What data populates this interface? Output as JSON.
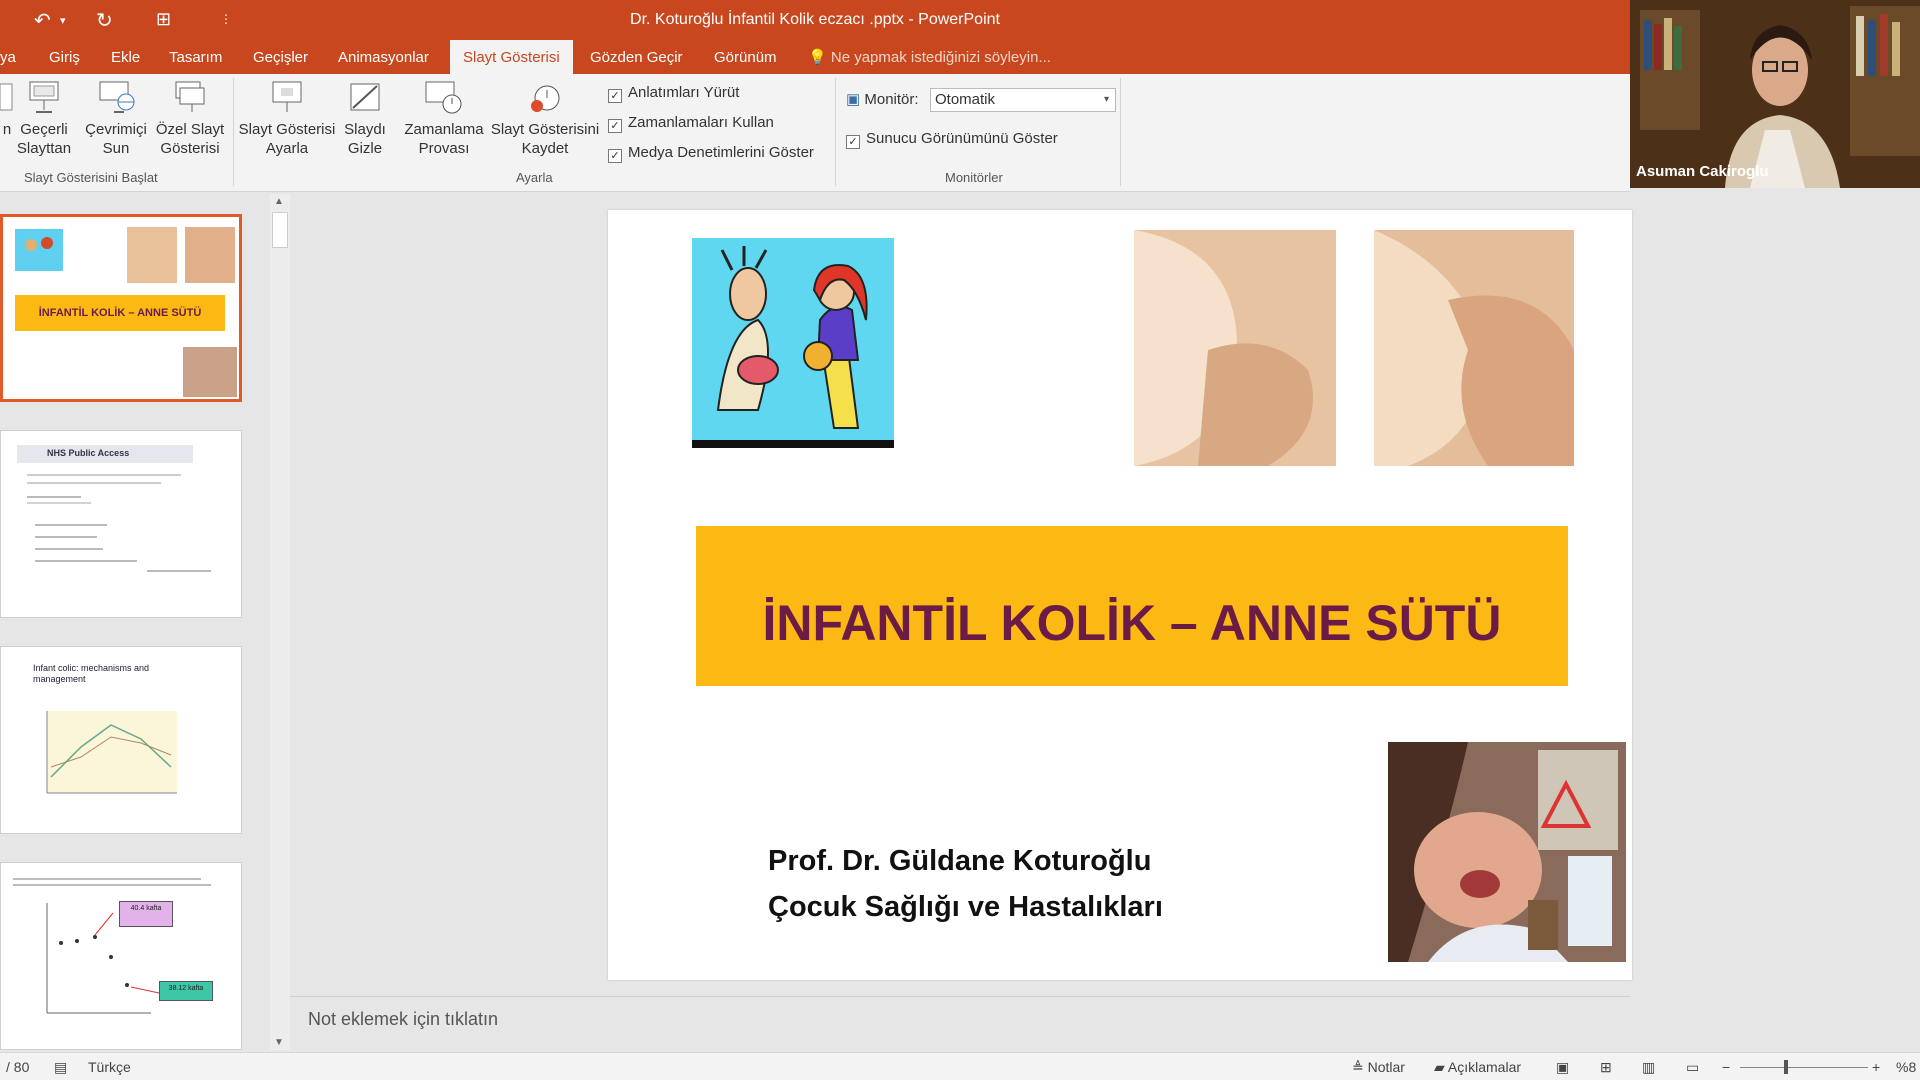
{
  "window": {
    "title": "Dr. Koturoğlu İnfantil Kolik eczacı .pptx - PowerPoint"
  },
  "ribbon_tabs": [
    {
      "label": "ya"
    },
    {
      "label": "Giriş"
    },
    {
      "label": "Ekle"
    },
    {
      "label": "Tasarım"
    },
    {
      "label": "Geçişler"
    },
    {
      "label": "Animasyonlar"
    },
    {
      "label": "Slayt Gösterisi",
      "active": true
    },
    {
      "label": "Gözden Geçir"
    },
    {
      "label": "Görünüm"
    }
  ],
  "tell_me": "Ne yapmak istediğinizi söyleyin...",
  "ribbon": {
    "start_group": {
      "label": "Slayt Gösterisini Başlat",
      "buttons": [
        "n",
        "Geçerli\nSlayttan",
        "Çevrimiçi\nSun",
        "Özel Slayt\nGösterisi"
      ]
    },
    "setup_group": {
      "label": "Ayarla",
      "buttons": [
        "Slayt Gösterisi\nAyarla",
        "Slaydı\nGizle",
        "Zamanlama\nProvası",
        "Slayt Gösterisini\nKaydet"
      ],
      "checkboxes": [
        "Anlatımları Yürüt",
        "Zamanlamaları Kullan",
        "Medya Denetimlerini Göster"
      ]
    },
    "monitors_group": {
      "label": "Monitörler",
      "monitor_label": "Monitör:",
      "monitor_value": "Otomatik",
      "presenter_view": "Sunucu Görünümünü Göster"
    }
  },
  "webcam": {
    "name": "Asuman Cakiroglu"
  },
  "thumbnails": [
    {
      "banner": "İNFANTİL KOLİK – ANNE SÜTÜ"
    },
    {
      "heading": "NHS Public Access"
    },
    {
      "heading": "Infant colic: mechanisms and management"
    },
    {
      "box1": "40.4 kafta",
      "box2": "38.12 kafta"
    }
  ],
  "slide": {
    "title": "İNFANTİL KOLİK – ANNE SÜTÜ",
    "author_line1": "Prof. Dr. Güldane Koturoğlu",
    "author_line2": "Çocuk Sağlığı ve Hastalıkları"
  },
  "notes_placeholder": "Not eklemek için tıklatın",
  "status": {
    "slide_count": "/ 80",
    "language": "Türkçe",
    "notes": "Notlar",
    "comments": "Açıklamalar",
    "zoom": "%8"
  },
  "colors": {
    "accent": "#c8471f",
    "banner": "#fdb913",
    "title_text": "#6a1c47"
  }
}
